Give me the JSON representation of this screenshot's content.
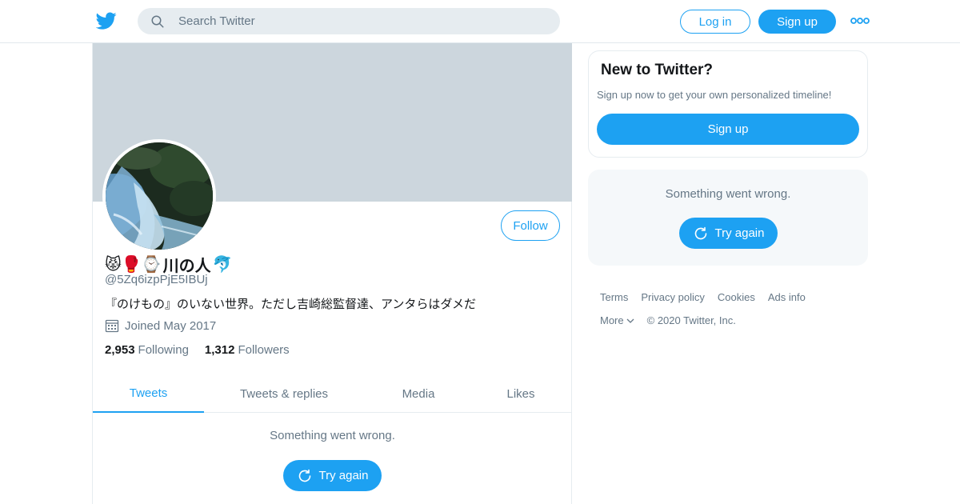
{
  "header": {
    "logo_icon": "twitter-bird-icon",
    "search_placeholder": "Search Twitter",
    "login_label": "Log in",
    "signup_label": "Sign up",
    "more_icon": "more-dots-icon"
  },
  "profile": {
    "name_emoji": "😾🥊⌚",
    "name_text": "川の人",
    "name_emoji_end": "🐬",
    "handle": "@5Zq6izpPjE5IBUj",
    "bio": "『のけもの』のいない世界。ただし吉崎総監督達、アンタらはダメだ",
    "joined": "Joined May 2017",
    "following_count": "2,953",
    "following_label": "Following",
    "followers_count": "1,312",
    "followers_label": "Followers",
    "follow_label": "Follow"
  },
  "tabs": [
    {
      "label": "Tweets",
      "active": true
    },
    {
      "label": "Tweets & replies",
      "active": false
    },
    {
      "label": "Media",
      "active": false
    },
    {
      "label": "Likes",
      "active": false
    }
  ],
  "timeline": {
    "error_message": "Something went wrong.",
    "try_again_label": "Try again"
  },
  "sidebar": {
    "new_title": "New to Twitter?",
    "new_subtitle": "Sign up now to get your own personalized timeline!",
    "signup_label": "Sign up",
    "error_message": "Something went wrong.",
    "try_again_label": "Try again"
  },
  "footer": {
    "links": [
      "Terms",
      "Privacy policy",
      "Cookies",
      "Ads info"
    ],
    "more_label": "More",
    "copyright": "© 2020 Twitter, Inc."
  },
  "colors": {
    "accent": "#1da1f2",
    "banner": "#ccd6dd",
    "muted": "#657786"
  }
}
